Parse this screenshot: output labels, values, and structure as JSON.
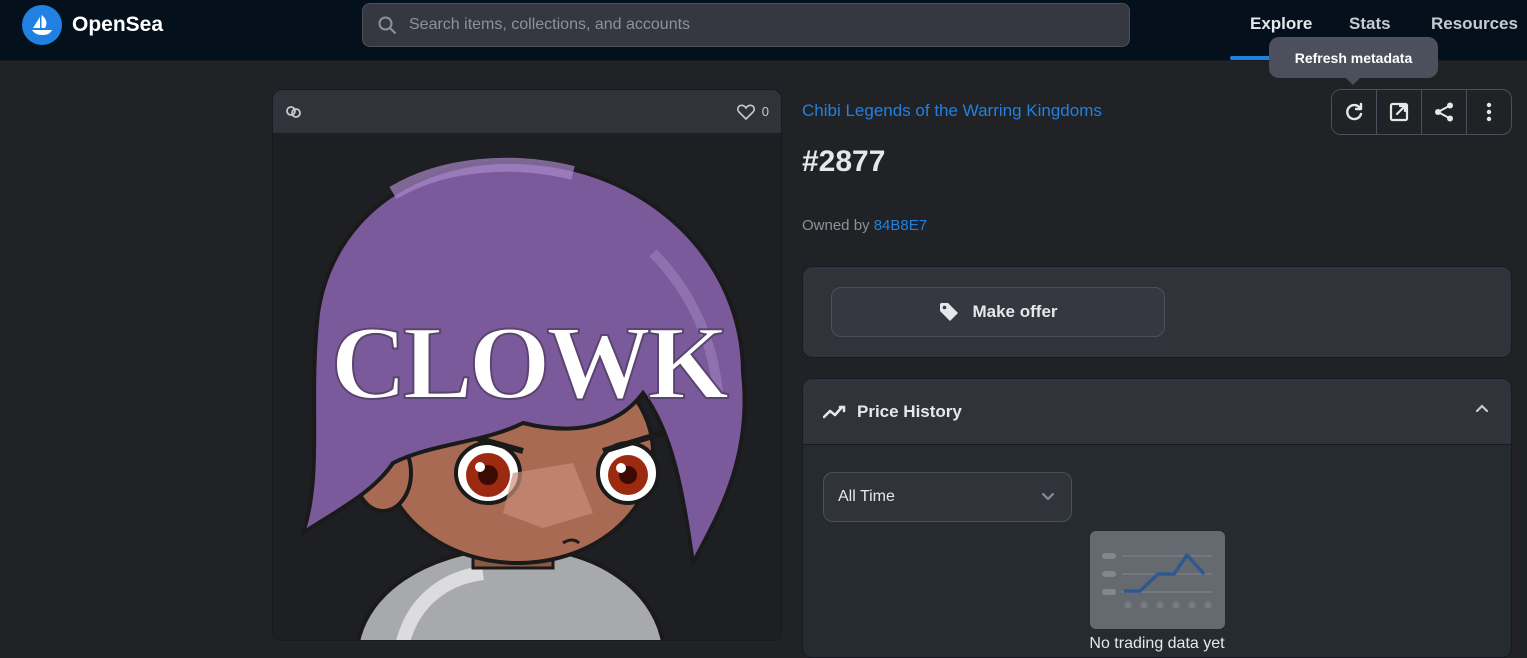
{
  "header": {
    "logo_text": "OpenSea",
    "search": {
      "placeholder": "Search items, collections, and accounts",
      "value": ""
    },
    "nav": {
      "explore": "Explore",
      "stats": "Stats",
      "resources": "Resources"
    }
  },
  "tooltip": {
    "text": "Refresh metadata"
  },
  "item_card": {
    "favorites_count": "0",
    "artwork_text": "CLOWK"
  },
  "item": {
    "collection": "Chibi Legends of the Warring Kingdoms",
    "title": "#2877",
    "owned_by_label": "Owned by",
    "owner": "84B8E7"
  },
  "actions": {
    "icons": [
      "refresh-icon",
      "external-link-icon",
      "share-icon",
      "more-vertical-icon"
    ]
  },
  "offer": {
    "make_offer_label": "Make offer"
  },
  "price_history": {
    "title": "Price History",
    "range_selected": "All Time",
    "empty_text": "No trading data yet"
  },
  "colors": {
    "accent": "#2081e2",
    "background": "#202225",
    "topbar": "#04111d",
    "panel": "#303339"
  }
}
